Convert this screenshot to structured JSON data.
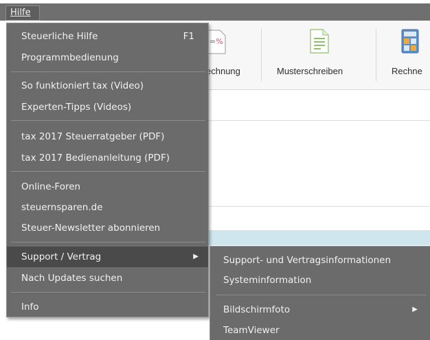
{
  "menubar": {
    "hilfe": "Hilfe"
  },
  "ribbon": {
    "items": [
      {
        "label": "echnung",
        "icon": "percent-document-icon"
      },
      {
        "label": "Musterschreiben",
        "icon": "document-icon"
      },
      {
        "label": "Rechne",
        "icon": "calculator-icon"
      }
    ]
  },
  "hilfe_menu": {
    "items": [
      {
        "label": "Steuerliche Hilfe",
        "shortcut": "F1"
      },
      {
        "label": "Programmbedienung"
      },
      {
        "label": "So funktioniert tax (Video)"
      },
      {
        "label": "Experten-Tipps (Videos)"
      },
      {
        "label": "tax 2017 Steuerratgeber (PDF)"
      },
      {
        "label": "tax 2017 Bedienanleitung (PDF)"
      },
      {
        "label": "Online-Foren"
      },
      {
        "label": "steuernsparen.de"
      },
      {
        "label": "Steuer-Newsletter abonnieren"
      },
      {
        "label": "Support / Vertrag",
        "submenu_arrow": "▶"
      },
      {
        "label": "Nach Updates suchen"
      },
      {
        "label": "Info"
      }
    ]
  },
  "support_submenu": {
    "items": [
      {
        "label": "Support- und Vertragsinformationen"
      },
      {
        "label": "Systeminformation"
      },
      {
        "label": "Bildschirmfoto",
        "submenu_arrow": "▶"
      },
      {
        "label": "TeamViewer"
      }
    ]
  },
  "colors": {
    "menu_bg": "#6b6b6b",
    "menu_highlight": "#4a4a4a",
    "menu_text": "#f1f1f1",
    "ribbon_bg": "#f7f7f7",
    "accent_band": "#cfe6ef"
  }
}
